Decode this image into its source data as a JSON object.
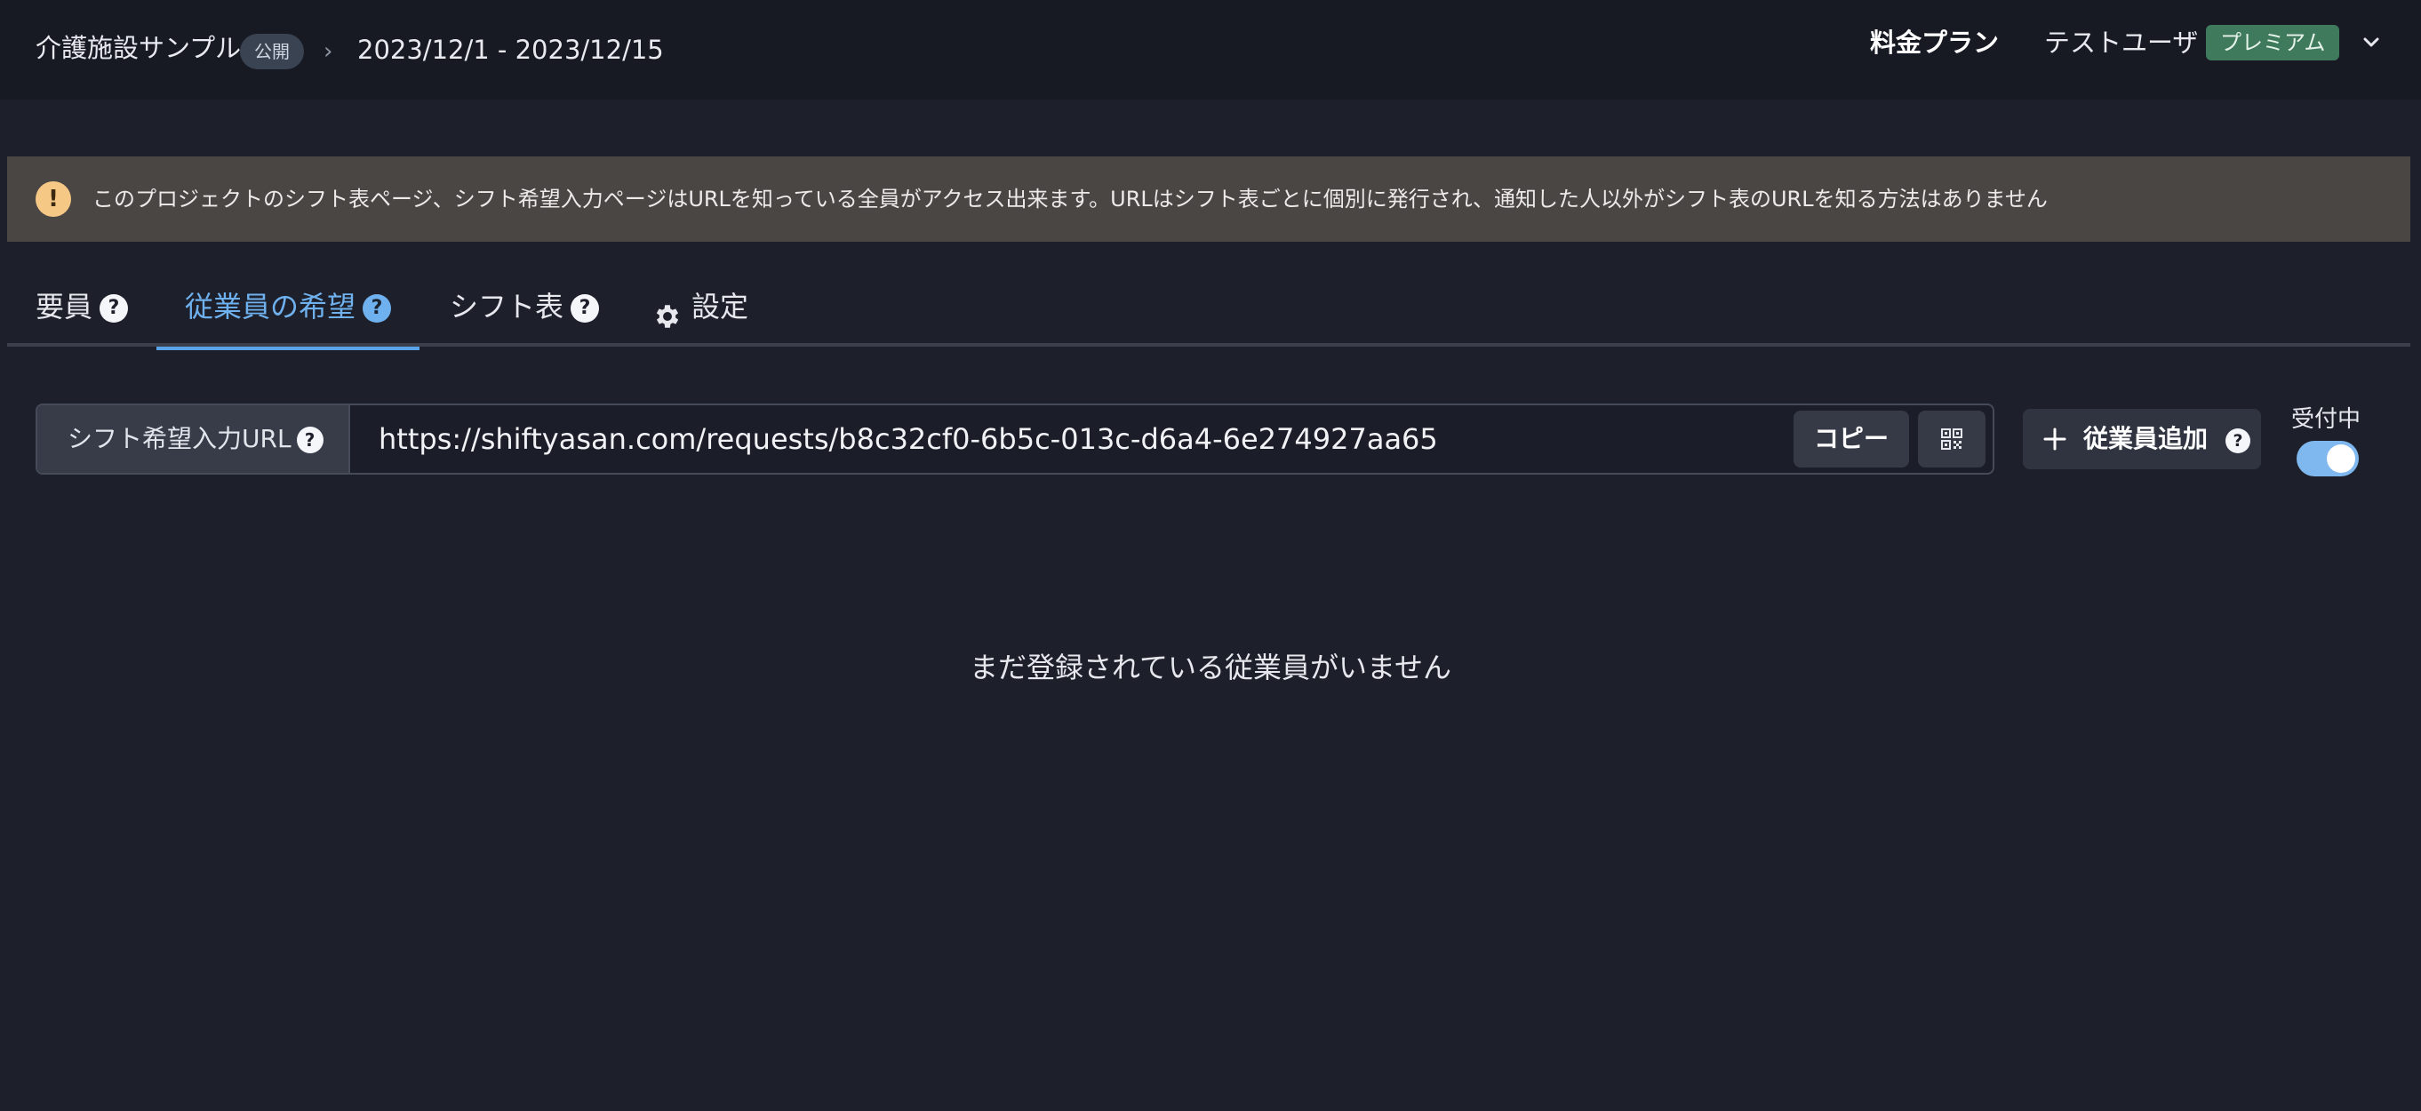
{
  "header": {
    "project_title": "介護施設サンプル",
    "public_badge": "公開",
    "breadcrumb_separator": "›",
    "date_range": "2023/12/1 - 2023/12/15",
    "pricing_link": "料金プラン",
    "user_name": "テストユーザ",
    "plan_badge": "プレミアム",
    "icons": {
      "user_menu": "chevron-down-icon"
    }
  },
  "notice": {
    "icon": "exclamation-icon",
    "text": "このプロジェクトのシフト表ページ、シフト希望入力ページはURLを知っている全員がアクセス出来ます。URLはシフト表ごとに個別に発行され、通知した人以外がシフト表のURLを知る方法はありません"
  },
  "tabs": [
    {
      "label": "要員",
      "help": "?",
      "active": false
    },
    {
      "label": "従業員の希望",
      "help": "?",
      "active": true
    },
    {
      "label": "シフト表",
      "help": "?",
      "active": false
    },
    {
      "label": "設定",
      "icon": "gear-icon",
      "active": false
    }
  ],
  "request_url": {
    "label": "シフト希望入力URL",
    "help": "?",
    "value": "https://shiftyasan.com/requests/b8c32cf0-6b5c-013c-d6a4-6e274927aa65",
    "copy_label": "コピー",
    "qr_icon": "qr-code-icon"
  },
  "add_employee": {
    "label": "従業員追加",
    "help": "?",
    "icon": "plus-icon"
  },
  "accepting": {
    "label": "受付中",
    "enabled": true
  },
  "empty_state": {
    "message": "まだ登録されている従業員がいません"
  },
  "colors": {
    "background": "#1d202b",
    "header": "#171a23",
    "accent": "#6fb1ee",
    "notice_bg": "#4a4643",
    "notice_icon": "#f6c886",
    "premium_badge": "#3f7a5c",
    "toggle_on": "#7fb8ee"
  }
}
